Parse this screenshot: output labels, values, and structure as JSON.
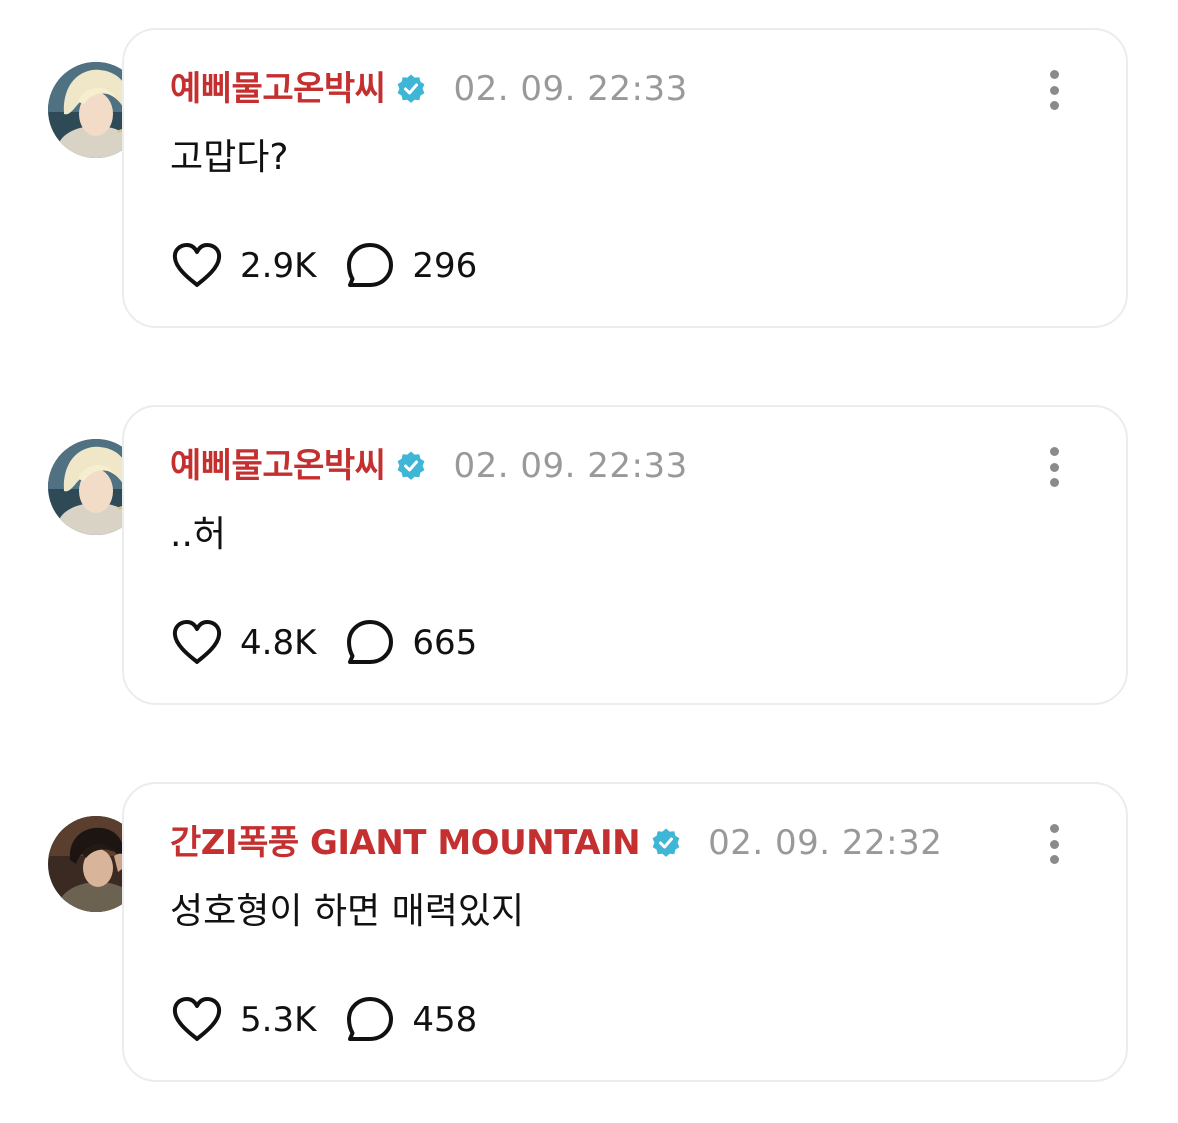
{
  "colors": {
    "username": "#c42f2f",
    "verified_badge": "#3fb6d6",
    "timestamp": "#999999",
    "card_border": "#ececef",
    "text": "#111111"
  },
  "posts": [
    {
      "username": "예삐물고온박씨",
      "verified": true,
      "timestamp": "02. 09. 22:33",
      "text": "고맙다?",
      "likes": "2.9K",
      "replies": "296",
      "avatar": "blonde-portrait-avatar"
    },
    {
      "username": "예삐물고온박씨",
      "verified": true,
      "timestamp": "02. 09. 22:33",
      "text": "..허",
      "likes": "4.8K",
      "replies": "665",
      "avatar": "blonde-portrait-avatar"
    },
    {
      "username": "간ZI폭풍 GIANT MOUNTAIN",
      "verified": true,
      "timestamp": "02. 09. 22:32",
      "text": "성호형이 하면 매력있지",
      "likes": "5.3K",
      "replies": "458",
      "avatar": "dark-hair-portrait-avatar"
    }
  ],
  "icons": {
    "like": "heart-icon",
    "reply": "speech-bubble-icon",
    "more": "more-vertical-icon",
    "verified": "verified-badge-icon"
  }
}
